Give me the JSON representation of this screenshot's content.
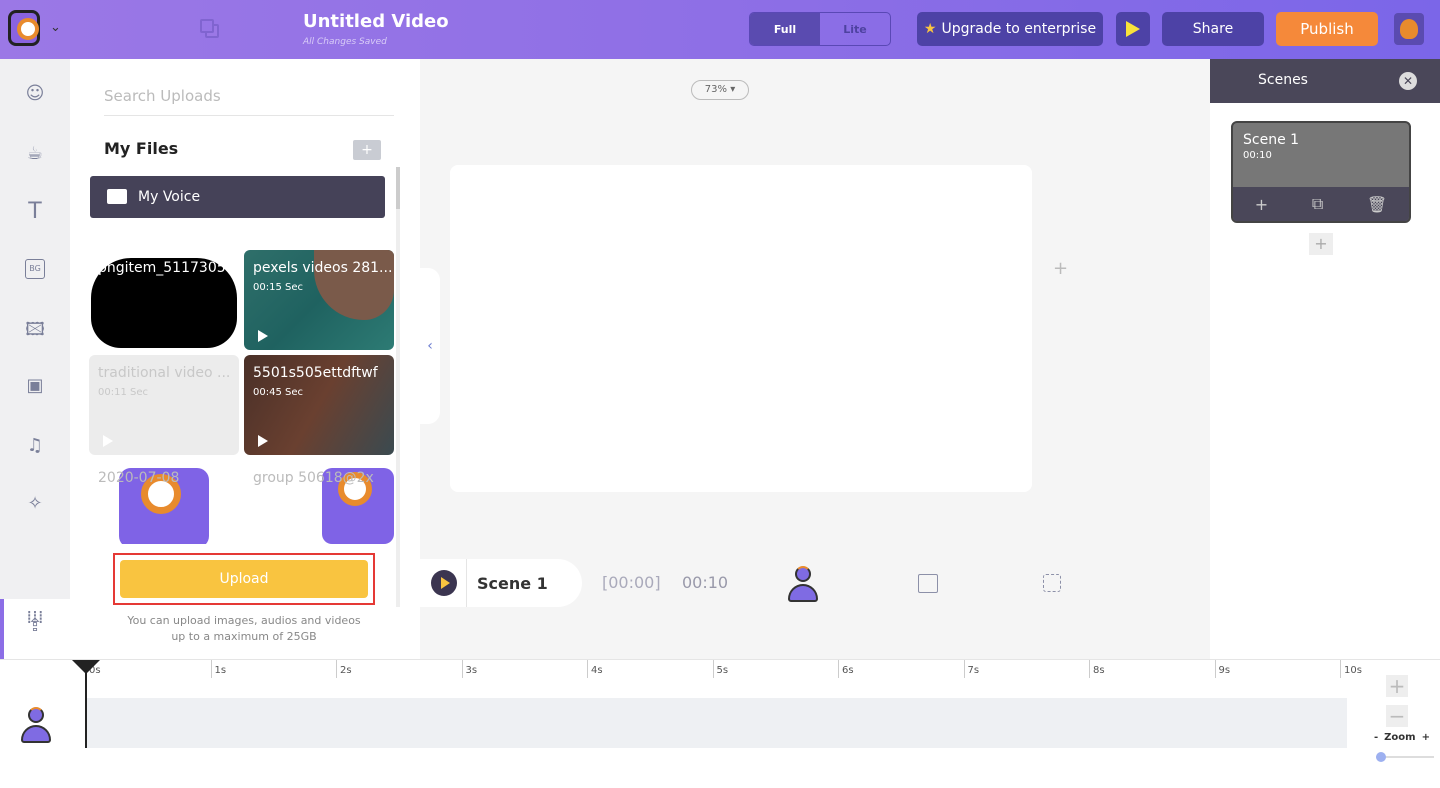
{
  "header": {
    "title": "Untitled Video",
    "save_status": "All Changes Saved",
    "mode_full": "Full",
    "mode_lite": "Lite",
    "upgrade": "Upgrade to enterprise",
    "share": "Share",
    "publish": "Publish",
    "accent": "#8e6fe6",
    "publish_color": "#f5893a"
  },
  "sidebar": {
    "icons": [
      "character-icon",
      "coffee-icon",
      "text-icon",
      "background-icon",
      "image-icon",
      "video-icon",
      "music-icon",
      "effects-icon",
      "upload-icon",
      "grid-icon"
    ],
    "active": "upload-icon"
  },
  "uploads": {
    "search_placeholder": "Search Uploads",
    "my_files": "My Files",
    "folder": "My Voice",
    "files": [
      {
        "name": "pngitem_5117305",
        "duration": ""
      },
      {
        "name": "pexels videos 281...",
        "duration": "00:15 Sec"
      },
      {
        "name": "traditional video ...",
        "duration": "00:11 Sec"
      },
      {
        "name": "5501s505ettdftwf",
        "duration": "00:45 Sec"
      },
      {
        "name": "2020-07-08",
        "duration": ""
      },
      {
        "name": "group 50618@2x",
        "duration": ""
      }
    ],
    "upload_button": "Upload",
    "hint_line1": "You can upload images, audios and videos",
    "hint_line2": "up to a maximum of 25GB",
    "upload_color": "#f9c440"
  },
  "canvas": {
    "zoom": "73%",
    "scene_name": "Scene 1",
    "current_time": "[00:00]",
    "duration": "00:10"
  },
  "scenes": {
    "title": "Scenes",
    "items": [
      {
        "name": "Scene 1",
        "duration": "00:10"
      }
    ]
  },
  "timeline": {
    "ticks": [
      "0s",
      "1s",
      "2s",
      "3s",
      "4s",
      "5s",
      "6s",
      "7s",
      "8s",
      "9s",
      "10s"
    ],
    "zoom_label": "Zoom",
    "zoom_minus": "-",
    "zoom_plus": "+",
    "zoom_level": 0
  }
}
